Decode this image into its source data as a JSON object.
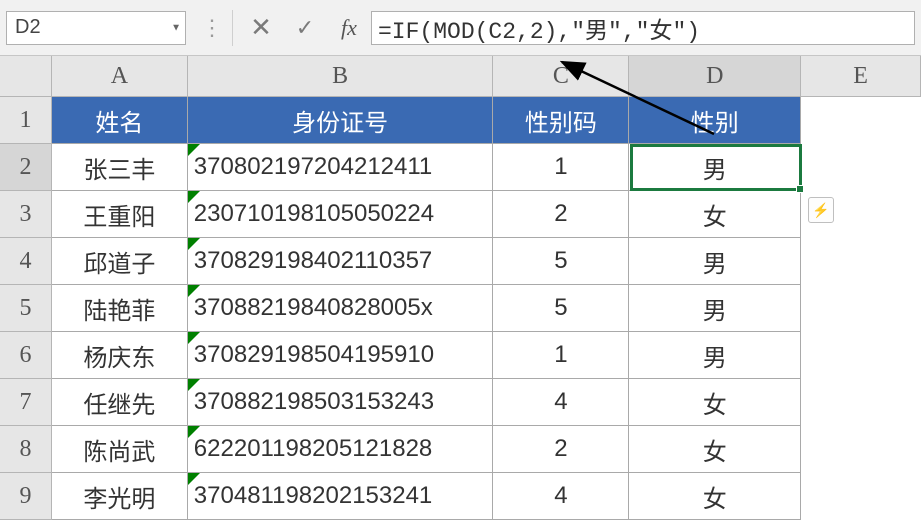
{
  "namebox": {
    "value": "D2"
  },
  "formula_bar": {
    "value": "=IF(MOD(C2,2),\"男\",\"女\")"
  },
  "columns": [
    "A",
    "B",
    "C",
    "D",
    "E"
  ],
  "selected_col": "D",
  "selected_row": 2,
  "header_row": {
    "A": "姓名",
    "B": "身份证号",
    "C": "性别码",
    "D": "性别"
  },
  "rows": [
    {
      "n": 2,
      "A": "张三丰",
      "B": "370802197204212411",
      "C": "1",
      "D": "男"
    },
    {
      "n": 3,
      "A": "王重阳",
      "B": "230710198105050224",
      "C": "2",
      "D": "女"
    },
    {
      "n": 4,
      "A": "邱道子",
      "B": "370829198402110357",
      "C": "5",
      "D": "男"
    },
    {
      "n": 5,
      "A": "陆艳菲",
      "B": "37088219840828005x",
      "C": "5",
      "D": "男"
    },
    {
      "n": 6,
      "A": "杨庆东",
      "B": "370829198504195910",
      "C": "1",
      "D": "男"
    },
    {
      "n": 7,
      "A": "任继先",
      "B": "370882198503153243",
      "C": "4",
      "D": "女"
    },
    {
      "n": 8,
      "A": "陈尚武",
      "B": "622201198205121828",
      "C": "2",
      "D": "女"
    },
    {
      "n": 9,
      "A": "李光明",
      "B": "370481198202153241",
      "C": "4",
      "D": "女"
    }
  ],
  "icons": {
    "dropdown": "▼",
    "cancel": "✕",
    "enter": "✓",
    "fx": "fx",
    "fill_lightning": "⚡"
  },
  "chart_data": {
    "type": "table",
    "headers": [
      "姓名",
      "身份证号",
      "性别码",
      "性别"
    ],
    "records": [
      [
        "张三丰",
        "370802197204212411",
        1,
        "男"
      ],
      [
        "王重阳",
        "230710198105050224",
        2,
        "女"
      ],
      [
        "邱道子",
        "370829198402110357",
        5,
        "男"
      ],
      [
        "陆艳菲",
        "37088219840828005x",
        5,
        "男"
      ],
      [
        "杨庆东",
        "370829198504195910",
        1,
        "男"
      ],
      [
        "任继先",
        "370882198503153243",
        4,
        "女"
      ],
      [
        "陈尚武",
        "622201198205121828",
        2,
        "女"
      ],
      [
        "李光明",
        "370481198202153241",
        4,
        "女"
      ]
    ]
  }
}
